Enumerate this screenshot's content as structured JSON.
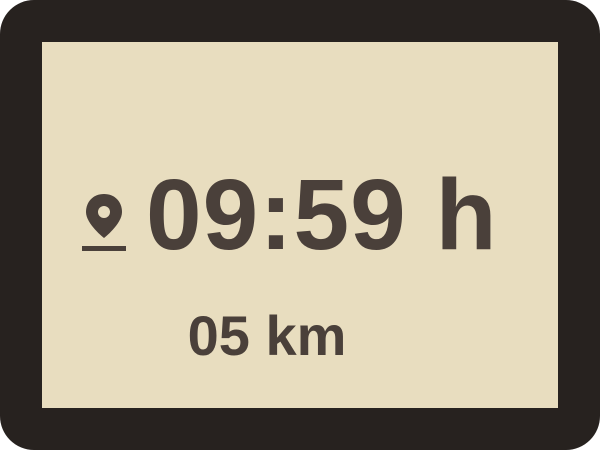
{
  "display": {
    "time_value": "09:59 h",
    "distance_value": "05 km",
    "location_icon": "map-pin-icon"
  },
  "colors": {
    "bezel": "#27221f",
    "screen_background": "#e8ddbf",
    "text": "#4a403a"
  }
}
